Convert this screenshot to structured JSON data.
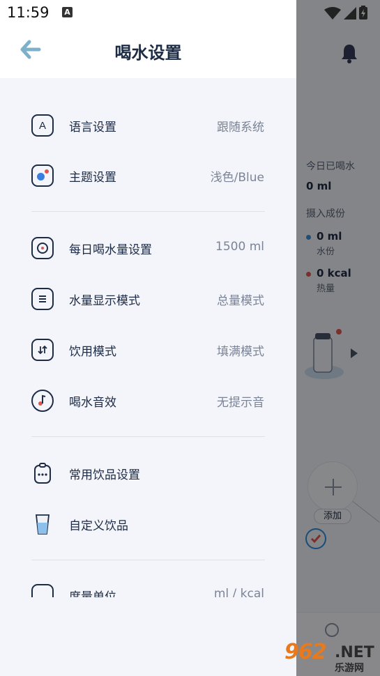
{
  "status_bar": {
    "time": "11:59",
    "badge": "A"
  },
  "drawer": {
    "title": "喝水设置",
    "items": [
      {
        "label": "语言设置",
        "value": "跟随系统",
        "icon": "language-icon"
      },
      {
        "label": "主题设置",
        "value": "浅色/Blue",
        "icon": "theme-icon"
      },
      {
        "label": "每日喝水量设置",
        "value": "1500 ml",
        "icon": "target-icon"
      },
      {
        "label": "水量显示模式",
        "value": "总量模式",
        "icon": "list-icon"
      },
      {
        "label": "饮用模式",
        "value": "填满模式",
        "icon": "sort-icon"
      },
      {
        "label": "喝水音效",
        "value": "无提示音",
        "icon": "music-note-icon"
      },
      {
        "label": "常用饮品设置",
        "value": "",
        "icon": "clipboard-icon"
      },
      {
        "label": "自定义饮品",
        "value": "",
        "icon": "cup-icon"
      },
      {
        "label": "度量单位",
        "value": "ml / kcal",
        "icon": "unit-icon"
      }
    ]
  },
  "background": {
    "today_label": "今日已喝水",
    "today_value": "0 ml",
    "intake_label": "摄入成份",
    "water_value": "0 ml",
    "water_label": "水份",
    "water_color": "#3a8fd6",
    "kcal_value": "0 kcal",
    "kcal_label": "热量",
    "kcal_color": "#e0574f",
    "add_label": "添加"
  },
  "watermark": {
    "big": "962",
    "net": ".NET",
    "cn": "乐游网"
  },
  "colors": {
    "accent": "#7fb0c9",
    "text": "#1d2b44",
    "drawer_bg": "#f3f5fa"
  }
}
